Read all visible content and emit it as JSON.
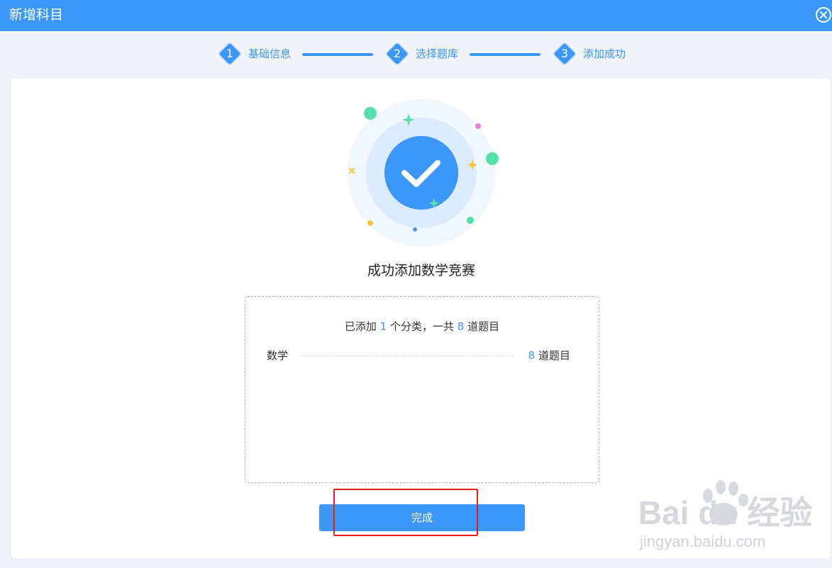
{
  "dialog": {
    "title": "新增科目"
  },
  "steps": [
    {
      "number": "1",
      "label": "基础信息"
    },
    {
      "number": "2",
      "label": "选择题库"
    },
    {
      "number": "3",
      "label": "添加成功"
    }
  ],
  "result": {
    "title": "成功添加数学竞赛",
    "summary_prefix": "已添加",
    "category_count": "1",
    "summary_middle": "个分类，一共",
    "question_count": "8",
    "summary_suffix": "道题目",
    "categories": [
      {
        "name": "数学",
        "count": "8",
        "unit": "道题目"
      }
    ]
  },
  "actions": {
    "done_label": "完成"
  },
  "watermark": {
    "brand": "Bai du 经验",
    "url": "jingyan.baidu.com"
  },
  "colors": {
    "accent": "#3d97f8",
    "highlight": "#e02020"
  }
}
